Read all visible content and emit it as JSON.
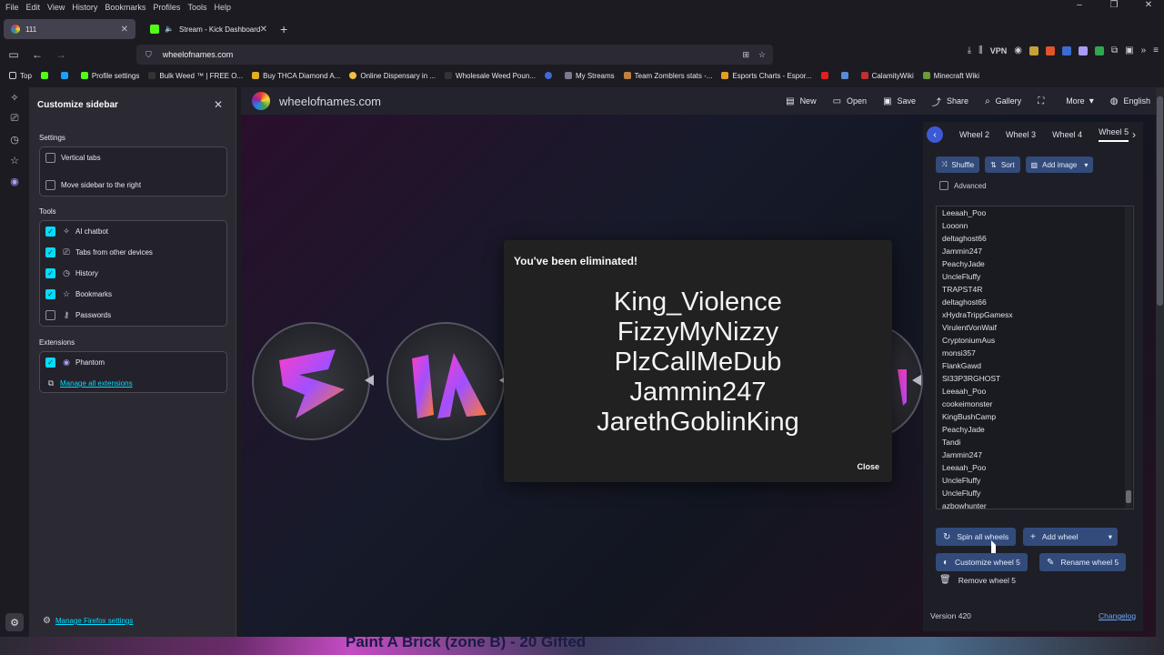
{
  "menubar": [
    "File",
    "Edit",
    "View",
    "History",
    "Bookmarks",
    "Profiles",
    "Tools",
    "Help"
  ],
  "tabs": [
    {
      "title": "111",
      "active": true
    },
    {
      "title": "Stream - Kick Dashboard",
      "active": false
    }
  ],
  "url": "wheelofnames.com",
  "vpn_label": "VPN",
  "bookmarks": [
    "Top",
    "Profile settings",
    "Bulk Weed ™ | FREE O...",
    "Buy THCA Diamond A...",
    "Online Dispensary in ...",
    "Wholesale Weed Poun...",
    "My Streams",
    "Team Zomblers stats -...",
    "Esports Charts - Espor...",
    "CalamityWiki",
    "Minecraft Wiki"
  ],
  "sidebar_panel": {
    "title": "Customize sidebar",
    "settings_label": "Settings",
    "settings": [
      {
        "label": "Vertical tabs",
        "checked": false
      },
      {
        "label": "Move sidebar to the right",
        "checked": false
      }
    ],
    "tools_label": "Tools",
    "tools": [
      {
        "label": "AI chatbot",
        "checked": true,
        "icon": "sparkle-icon"
      },
      {
        "label": "Tabs from other devices",
        "checked": true,
        "icon": "devices-icon"
      },
      {
        "label": "History",
        "checked": true,
        "icon": "clock-icon"
      },
      {
        "label": "Bookmarks",
        "checked": true,
        "icon": "star-icon"
      },
      {
        "label": "Passwords",
        "checked": false,
        "icon": "key-icon"
      }
    ],
    "extensions_label": "Extensions",
    "extensions": [
      {
        "label": "Phantom",
        "checked": true
      }
    ],
    "manage_extensions": "Manage all extensions",
    "manage_firefox": "Manage Firefox settings"
  },
  "site": {
    "name": "wheelofnames.com",
    "menu": [
      {
        "label": "New",
        "icon": "file-icon"
      },
      {
        "label": "Open",
        "icon": "folder-icon"
      },
      {
        "label": "Save",
        "icon": "save-icon"
      },
      {
        "label": "Share",
        "icon": "share-icon"
      },
      {
        "label": "Gallery",
        "icon": "search-icon"
      },
      {
        "label": "",
        "icon": "fullscreen-icon"
      },
      {
        "label": "More",
        "icon": "chevron-down-icon"
      },
      {
        "label": "English",
        "icon": "globe-icon"
      }
    ]
  },
  "modal": {
    "title": "You've been eliminated!",
    "names": [
      "King_Violence",
      "FizzyMyNizzy",
      "PlzCallMeDub",
      "Jammin247",
      "JarethGoblinKing"
    ],
    "close": "Close"
  },
  "wheel_tabs": [
    "Wheel 2",
    "Wheel 3",
    "Wheel 4",
    "Wheel 5"
  ],
  "toolbar": {
    "shuffle": "Shuffle",
    "sort": "Sort",
    "add_image": "Add image"
  },
  "advanced": "Advanced",
  "entries": [
    "Leeaah_Poo",
    "Looonn",
    "deltaghost66",
    "Jammin247",
    "PeachyJade",
    "UncleFluffy",
    "TRAPST4R",
    "deltaghost66",
    "xHydraTrippGamesx",
    "VirulentVonWaif",
    "CryptoniumAus",
    "monsi357",
    "FlankGawd",
    "SI33P3RGHOST",
    "Leeaah_Poo",
    "cookeimonster",
    "KingBushCamp",
    "PeachyJade",
    "Tandi",
    "Jammin247",
    "Leeaah_Poo",
    "UncleFluffy",
    "UncleFluffy",
    "azbowhunter"
  ],
  "actions": {
    "spin_all": "Spin all wheels",
    "add_wheel": "Add wheel",
    "customize": "Customize wheel 5",
    "rename": "Rename wheel 5",
    "remove": "Remove wheel 5"
  },
  "version": "Version 420",
  "changelog": "Changelog",
  "overlay_text": "Paint A Brick (zone B) - 20 Gifted",
  "colors": {
    "accent": "#00ddff",
    "button": "#324b7a",
    "wheel_tab_arrow": "#3d5ad6"
  }
}
